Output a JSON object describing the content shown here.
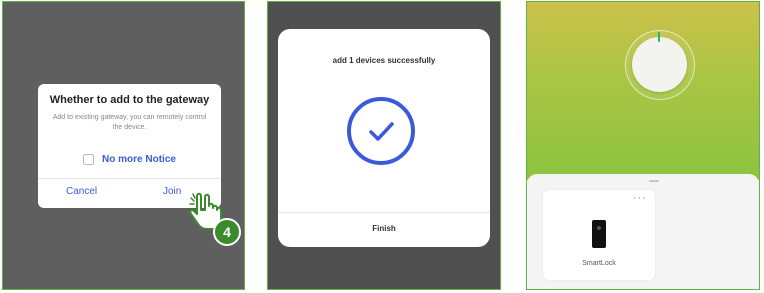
{
  "gateway_dialog": {
    "title": "Whether to add to the gateway",
    "description": "Add to existing gateway, you can remotely control the device.",
    "no_more_notice": "No more Notice",
    "cancel": "Cancel",
    "join": "Join",
    "step_number": "4"
  },
  "success_dialog": {
    "title": "add 1 devices successfully",
    "finish": "Finish"
  },
  "device_screen": {
    "device_name": "SmartLock",
    "more_glyph": "···"
  },
  "colors": {
    "accent_blue": "#3a5bd9",
    "panel_border_green": "#5fb246",
    "step_badge_green": "#3c8a2e",
    "gradient_top": "#cdc14a",
    "gradient_bottom": "#8cc43f"
  }
}
